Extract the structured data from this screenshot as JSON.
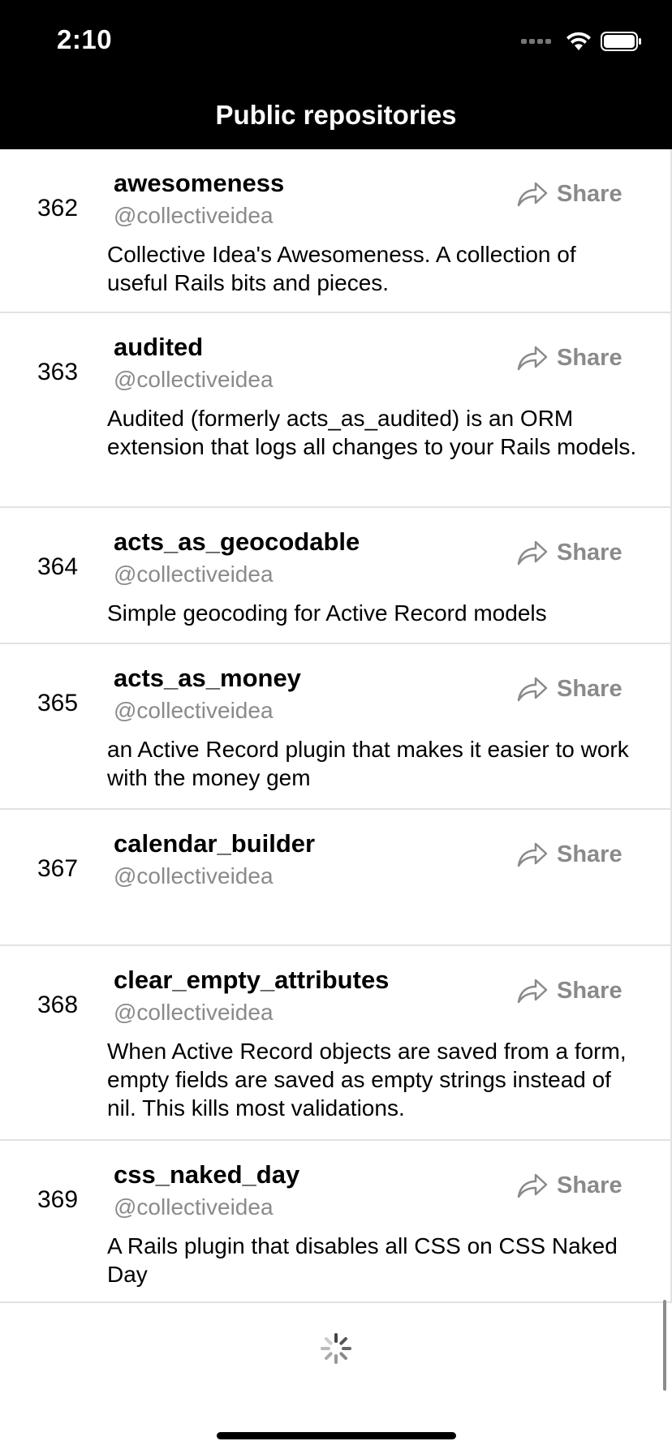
{
  "status_bar": {
    "time": "2:10"
  },
  "nav": {
    "title": "Public repositories"
  },
  "share_label": "Share",
  "repos": [
    {
      "index": "362",
      "name": "awesomeness",
      "owner": "@collectiveidea",
      "description": "Collective Idea's Awesomeness.  A collection of useful Rails bits and pieces."
    },
    {
      "index": "363",
      "name": "audited",
      "owner": "@collectiveidea",
      "description": "Audited (formerly acts_as_audited) is an ORM extension that logs all changes to your Rails models."
    },
    {
      "index": "364",
      "name": "acts_as_geocodable",
      "owner": "@collectiveidea",
      "description": "Simple geocoding for Active Record models"
    },
    {
      "index": "365",
      "name": "acts_as_money",
      "owner": "@collectiveidea",
      "description": "an Active Record plugin that makes it easier to work with the money gem"
    },
    {
      "index": "367",
      "name": "calendar_builder",
      "owner": "@collectiveidea",
      "description": ""
    },
    {
      "index": "368",
      "name": "clear_empty_attributes",
      "owner": "@collectiveidea",
      "description": "When Active Record objects are saved from a form, empty fields are saved as empty strings instead of nil.  This kills most validations."
    },
    {
      "index": "369",
      "name": "css_naked_day",
      "owner": "@collectiveidea",
      "description": "A Rails plugin that disables all CSS on CSS Naked Day"
    }
  ]
}
